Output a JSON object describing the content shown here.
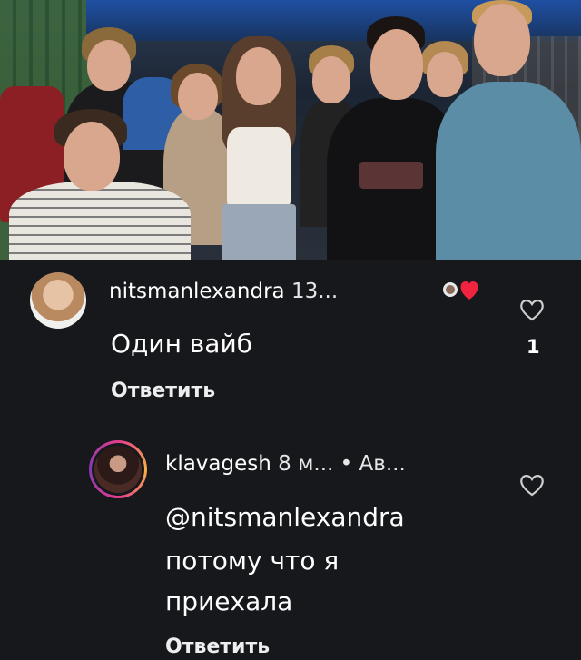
{
  "video": {
    "description_icon": "video-frame"
  },
  "comments": [
    {
      "username": "nitsmanlexandra",
      "meta": "13...",
      "text": "Один вайб",
      "reply_label": "Ответить",
      "like_icon": "heart-outline-icon",
      "like_count": "1",
      "liked_by_creator_icon": "creator-heart-icon"
    }
  ],
  "replies": [
    {
      "username": "klavagesh",
      "meta": "8 м... • Ав...",
      "mention": "@nitsmanlexandra",
      "text_line_2": "потому что я",
      "text_line_3": "приехала",
      "reply_label": "Ответить",
      "like_icon": "heart-outline-icon"
    }
  ],
  "colors": {
    "background": "#16181c",
    "text": "#ffffff",
    "heart_red": "#f0243f"
  }
}
